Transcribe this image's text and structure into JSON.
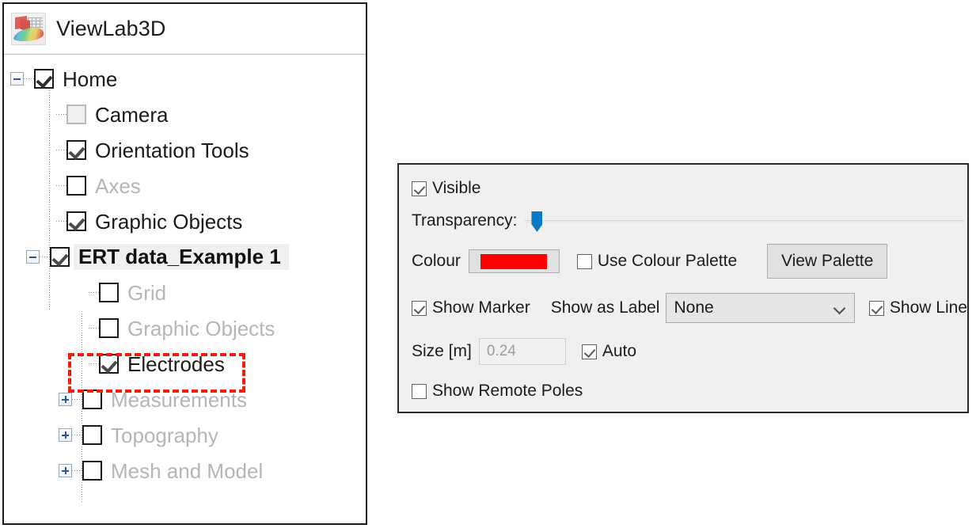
{
  "app": {
    "title": "ViewLab3D",
    "icon": "app-3d-thumbnail-icon"
  },
  "tree": {
    "items": [
      {
        "label": "Home",
        "checked": true,
        "dimmed": false,
        "bold": false,
        "expander": "minus",
        "depth": 0,
        "selected": false
      },
      {
        "label": "Camera",
        "checked": false,
        "dimmed": false,
        "bold": false,
        "expander": "none",
        "depth": 1,
        "selected": false
      },
      {
        "label": "Orientation Tools",
        "checked": true,
        "dimmed": false,
        "bold": false,
        "expander": "none",
        "depth": 1,
        "selected": false
      },
      {
        "label": "Axes",
        "checked": false,
        "dimmed": true,
        "bold": false,
        "expander": "none",
        "depth": 1,
        "selected": false
      },
      {
        "label": "Graphic Objects",
        "checked": true,
        "dimmed": false,
        "bold": false,
        "expander": "none",
        "depth": 1,
        "selected": false
      },
      {
        "label": "ERT data_Example 1",
        "checked": true,
        "dimmed": false,
        "bold": true,
        "expander": "minus",
        "depth": 1,
        "selected": true
      },
      {
        "label": "Grid",
        "checked": false,
        "dimmed": true,
        "bold": false,
        "expander": "none",
        "depth": 2,
        "selected": false
      },
      {
        "label": "Graphic Objects",
        "checked": false,
        "dimmed": true,
        "bold": false,
        "expander": "none",
        "depth": 2,
        "selected": false
      },
      {
        "label": "Electrodes",
        "checked": true,
        "dimmed": false,
        "bold": false,
        "expander": "none",
        "depth": 2,
        "selected": false
      },
      {
        "label": "Measurements",
        "checked": false,
        "dimmed": true,
        "bold": false,
        "expander": "plus",
        "depth": 2,
        "selected": false
      },
      {
        "label": "Topography",
        "checked": false,
        "dimmed": true,
        "bold": false,
        "expander": "plus",
        "depth": 2,
        "selected": false
      },
      {
        "label": "Mesh and Model",
        "checked": false,
        "dimmed": true,
        "bold": false,
        "expander": "plus",
        "depth": 2,
        "selected": false
      }
    ],
    "highlight": {
      "target_label": "Electrodes",
      "color": "#f41c0c",
      "style": "dashed"
    }
  },
  "properties": {
    "visible": {
      "label": "Visible",
      "checked": true
    },
    "transparency": {
      "label": "Transparency:",
      "value": 0
    },
    "colour": {
      "label": "Colour",
      "swatch_color": "#fe0000",
      "use_palette_label": "Use Colour Palette",
      "use_palette_checked": false,
      "view_palette_label": "View Palette"
    },
    "show_marker": {
      "label": "Show Marker",
      "checked": true
    },
    "show_as_label": {
      "label": "Show as Label",
      "value": "None"
    },
    "show_line": {
      "label": "Show Line",
      "checked": true
    },
    "size": {
      "label": "Size [m]",
      "value": "0.24",
      "auto_label": "Auto",
      "auto_checked": true
    },
    "show_remote_poles": {
      "label": "Show Remote Poles",
      "checked": false
    }
  }
}
